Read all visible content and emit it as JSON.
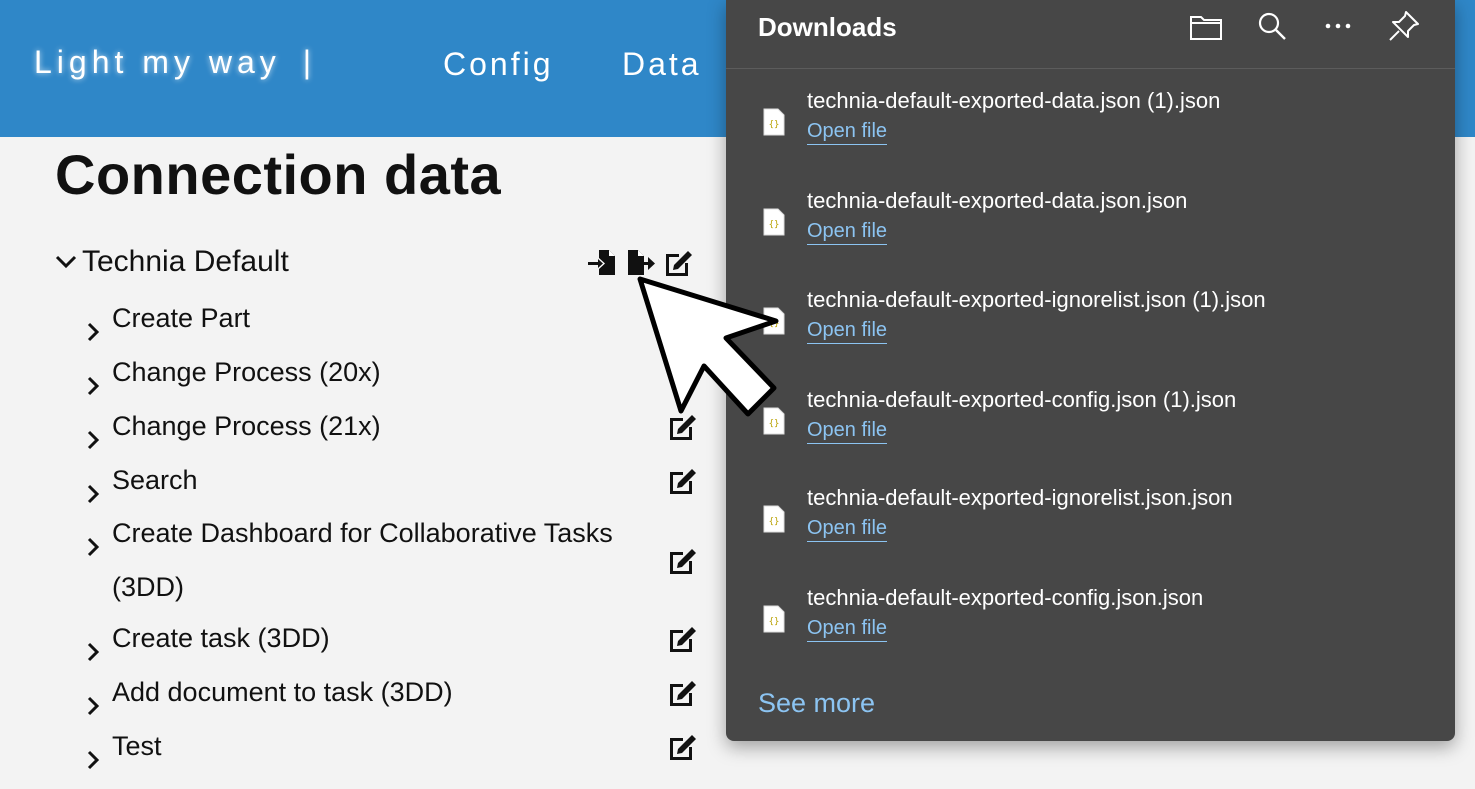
{
  "header": {
    "brand": "Light my way",
    "separator": "|",
    "nav": [
      "Config",
      "Data"
    ],
    "bg_color": "#2f87c8"
  },
  "main": {
    "title": "Connection data",
    "group": {
      "label": "Technia Default",
      "expanded": true,
      "actions": [
        "import-icon",
        "export-icon",
        "edit-icon"
      ]
    },
    "items": [
      {
        "label": "Create Part"
      },
      {
        "label": "Change Process (20x)"
      },
      {
        "label": "Change Process (21x)"
      },
      {
        "label": "Search"
      },
      {
        "label": "Create Dashboard for Collaborative Tasks (3DD)"
      },
      {
        "label": "Create task (3DD)"
      },
      {
        "label": "Add document to task (3DD)"
      },
      {
        "label": "Test"
      }
    ]
  },
  "downloads": {
    "title": "Downloads",
    "tools": [
      "folder-icon",
      "search-icon",
      "more-icon",
      "pin-icon"
    ],
    "open_label": "Open file",
    "files": [
      "technia-default-exported-data.json (1).json",
      "technia-default-exported-data.json.json",
      "technia-default-exported-ignorelist.json (1).json",
      "technia-default-exported-config.json (1).json",
      "technia-default-exported-ignorelist.json.json",
      "technia-default-exported-config.json.json"
    ],
    "see_more": "See more",
    "panel_color": "#474747",
    "link_color": "#8cc4f2"
  }
}
